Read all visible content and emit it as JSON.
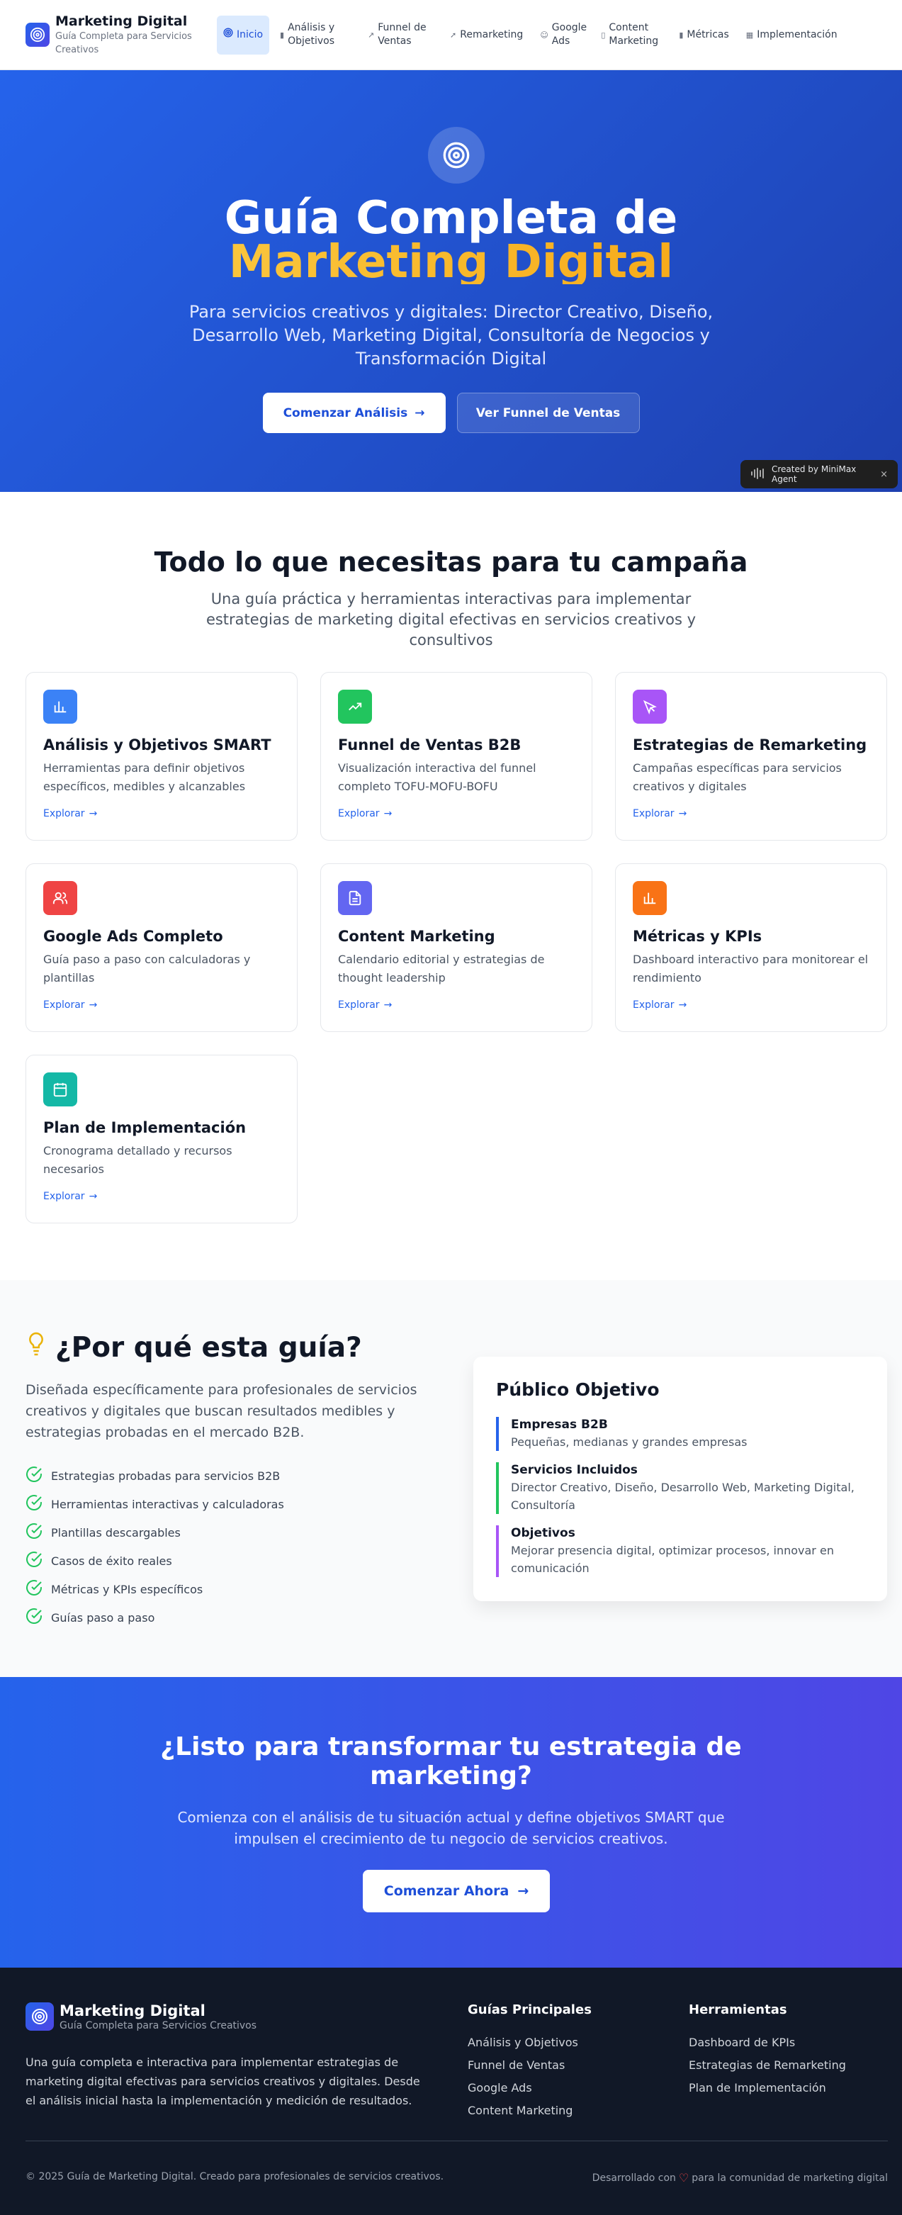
{
  "nav": {
    "brand_title": "Marketing Digital",
    "brand_subtitle": "Guía Completa para Servicios Creativos",
    "items": [
      {
        "label": "Inicio",
        "icon": "target-icon",
        "active": true
      },
      {
        "label": "Análisis y Objetivos",
        "icon": "bar-chart-icon"
      },
      {
        "label": "Funnel de Ventas",
        "icon": "trending-up-icon"
      },
      {
        "label": "Remarketing",
        "icon": "cursor-icon"
      },
      {
        "label": "Google Ads",
        "icon": "users-icon"
      },
      {
        "label": "Content Marketing",
        "icon": "file-text-icon"
      },
      {
        "label": "Métricas",
        "icon": "bar-chart-icon"
      },
      {
        "label": "Implementación",
        "icon": "calendar-icon"
      }
    ]
  },
  "hero": {
    "title_line1": "Guía Completa de",
    "title_line2": "Marketing Digital",
    "description": "Para servicios creativos y digitales: Director Creativo, Diseño, Desarrollo Web, Marketing Digital, Consultoría de Negocios y Transformación Digital",
    "primary_button": "Comenzar Análisis",
    "secondary_button": "Ver Funnel de Ventas"
  },
  "badge": {
    "label": "Created by MiniMax Agent",
    "close": "×"
  },
  "features": {
    "title": "Todo lo que necesitas para tu campaña",
    "description": "Una guía práctica y herramientas interactivas para implementar estrategias de marketing digital efectivas en servicios creativos y consultivos",
    "link_label": "Explorar",
    "cards": [
      {
        "title": "Análisis y Objetivos SMART",
        "description": "Herramientas para definir objetivos específicos, medibles y alcanzables",
        "icon": "bar-chart-icon",
        "color": "#3b82f6"
      },
      {
        "title": "Funnel de Ventas B2B",
        "description": "Visualización interactiva del funnel completo TOFU-MOFU-BOFU",
        "icon": "trending-up-icon",
        "color": "#22c55e"
      },
      {
        "title": "Estrategias de Remarketing",
        "description": "Campañas específicas para servicios creativos y digitales",
        "icon": "cursor-icon",
        "color": "#a855f7"
      },
      {
        "title": "Google Ads Completo",
        "description": "Guía paso a paso con calculadoras y plantillas",
        "icon": "users-icon",
        "color": "#ef4444"
      },
      {
        "title": "Content Marketing",
        "description": "Calendario editorial y estrategias de thought leadership",
        "icon": "file-text-icon",
        "color": "#6366f1"
      },
      {
        "title": "Métricas y KPIs",
        "description": "Dashboard interactivo para monitorear el rendimiento",
        "icon": "bar-chart-icon",
        "color": "#f97316"
      },
      {
        "title": "Plan de Implementación",
        "description": "Cronograma detallado y recursos necesarios",
        "icon": "calendar-icon",
        "color": "#14b8a6"
      }
    ]
  },
  "why": {
    "title": "¿Por qué esta guía?",
    "description": "Diseñada específicamente para profesionales de servicios creativos y digitales que buscan resultados medibles y estrategias probadas en el mercado B2B.",
    "benefits": [
      "Estrategias probadas para servicios B2B",
      "Herramientas interactivas y calculadoras",
      "Plantillas descargables",
      "Casos de éxito reales",
      "Métricas y KPIs específicos",
      "Guías paso a paso"
    ],
    "audience": {
      "title": "Público Objetivo",
      "items": [
        {
          "title": "Empresas B2B",
          "description": "Pequeñas, medianas y grandes empresas",
          "color": "#2563eb"
        },
        {
          "title": "Servicios Incluidos",
          "description": "Director Creativo, Diseño, Desarrollo Web, Marketing Digital, Consultoría",
          "color": "#22c55e"
        },
        {
          "title": "Objetivos",
          "description": "Mejorar presencia digital, optimizar procesos, innovar en comunicación",
          "color": "#a855f7"
        }
      ]
    }
  },
  "cta": {
    "title": "¿Listo para transformar tu estrategia de marketing?",
    "description": "Comienza con el análisis de tu situación actual y define objetivos SMART que impulsen el crecimiento de tu negocio de servicios creativos.",
    "button": "Comenzar Ahora"
  },
  "footer": {
    "brand_title": "Marketing Digital",
    "brand_subtitle": "Guía Completa para Servicios Creativos",
    "description": "Una guía completa e interactiva para implementar estrategias de marketing digital efectivas para servicios creativos y digitales. Desde el análisis inicial hasta la implementación y medición de resultados.",
    "col1": {
      "title": "Guías Principales",
      "links": [
        "Análisis y Objetivos",
        "Funnel de Ventas",
        "Google Ads",
        "Content Marketing"
      ]
    },
    "col2": {
      "title": "Herramientas",
      "links": [
        "Dashboard de KPIs",
        "Estrategias de Remarketing",
        "Plan de Implementación"
      ]
    },
    "copyright": "© 2025 Guía de Marketing Digital. Creado para profesionales de servicios creativos.",
    "made_prefix": "Desarrollado con",
    "made_suffix": "para la comunidad de marketing digital"
  }
}
